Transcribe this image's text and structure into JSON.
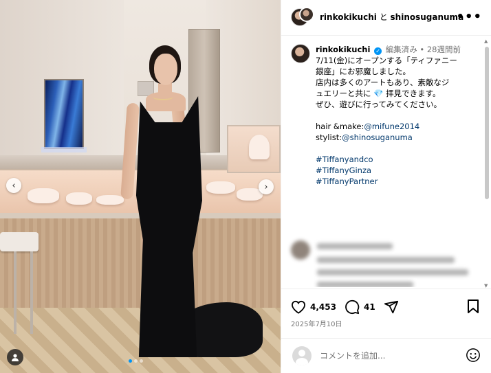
{
  "post_image": {
    "carousel_dots": 3,
    "active_dot": 1
  },
  "header": {
    "username": "rinkokikuchi",
    "separator": " と ",
    "collaborator": "shinosuganuma",
    "more_icon": "more-horizontal-icon"
  },
  "caption": {
    "username": "rinkokikuchi",
    "verified_icon": "verified-badge-icon",
    "edited": "編集済み",
    "dot": " • ",
    "time_ago": "28週間前",
    "lines": [
      "7/11(金)にオープンする「ティファニー",
      "銀座」にお邪魔しました。",
      "店内は多くのアートもあり、素敵なジ",
      "ュエリーと共に",
      "拝見できます。",
      "ぜひ、遊びに行ってみてください。"
    ],
    "diamond_emoji": "💎",
    "hair_make_label": "hair &make:",
    "hair_make_handle": "@mifune2014",
    "stylist_label": "stylist:",
    "stylist_handle": "@shinosuganuma",
    "hashtags": [
      "#Tiffanyandco",
      "#TiffanyGinza",
      "#TiffanyPartner"
    ]
  },
  "actions": {
    "like_count": "4,453",
    "comment_count": "41",
    "like_icon": "heart-icon",
    "comment_icon": "comment-bubble-icon",
    "share_icon": "share-paper-plane-icon",
    "save_icon": "bookmark-icon",
    "date": "2025年7月10日"
  },
  "comment_box": {
    "placeholder": "コメントを追加...",
    "emoji_icon": "emoji-smiley-icon"
  },
  "colors": {
    "link": "#00376b",
    "verified": "#0095f6",
    "meta_gray": "#737373"
  }
}
